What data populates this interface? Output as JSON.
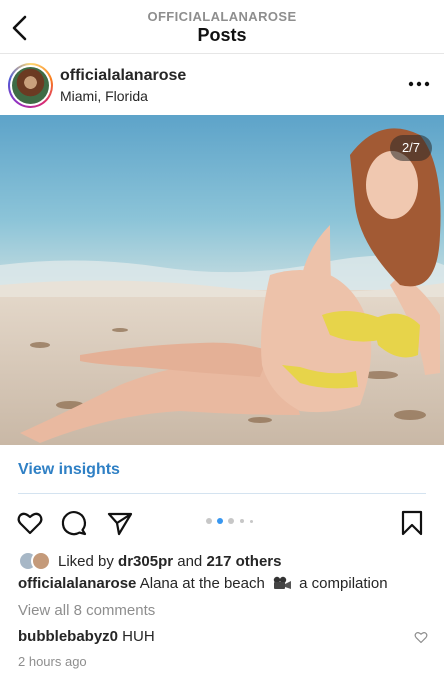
{
  "header": {
    "subtitle": "OFFICIALALANAROSE",
    "title": "Posts"
  },
  "post": {
    "username": "officialalanarose",
    "location": "Miami, Florida",
    "image_counter": "2/7",
    "insights_label": "View insights",
    "carousel": {
      "total_dots": 5,
      "active_index": 1
    },
    "likes": {
      "prefix": "Liked by ",
      "liker": "dr305pr",
      "joiner": " and ",
      "others": "217 others"
    },
    "caption": {
      "username": "officialalanarose",
      "text_before_icon": " Alana at the beach ",
      "icon": "movie-camera-icon",
      "text_after_icon": " a compilation"
    },
    "view_comments": "View all 8 comments",
    "top_comment": {
      "username": "bubblebabyz0",
      "text": " HUH"
    },
    "timestamp": "2 hours ago"
  },
  "colors": {
    "link": "#2f80c5",
    "muted": "#8e8e8e",
    "text": "#262626"
  }
}
